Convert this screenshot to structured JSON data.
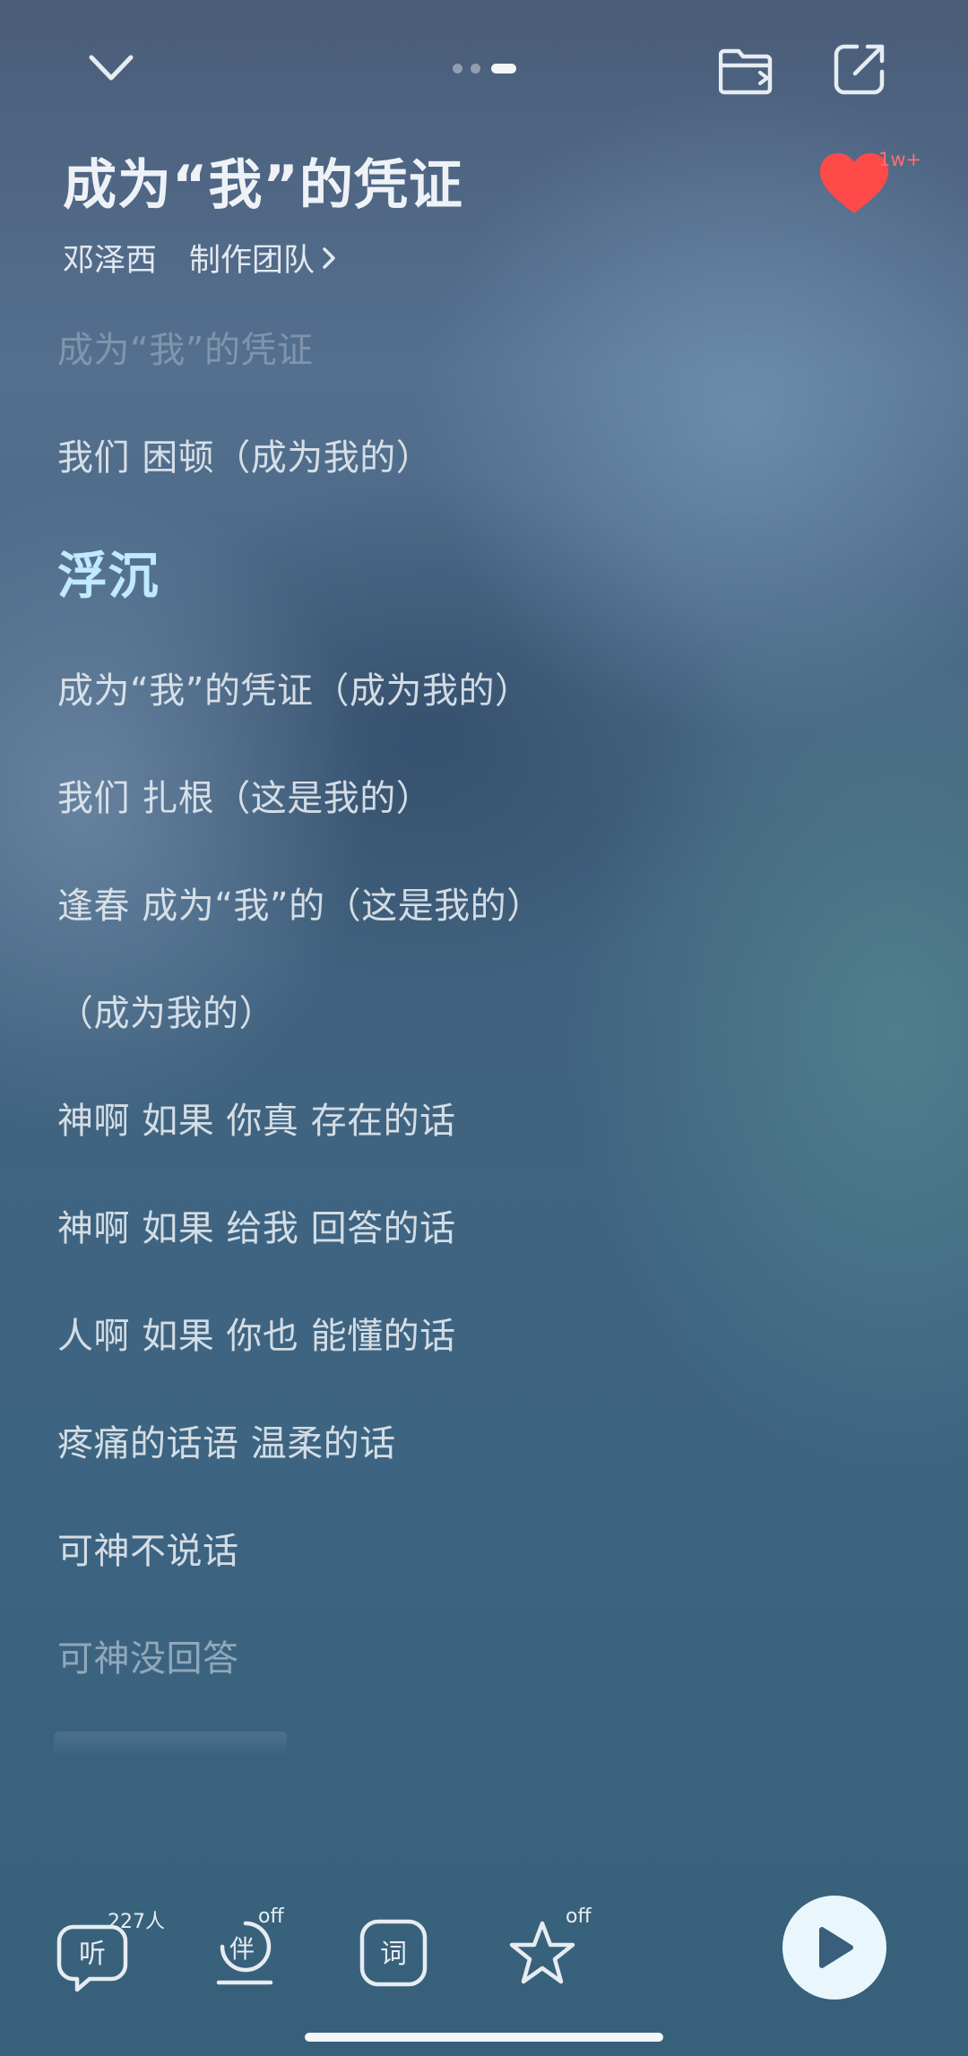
{
  "header": {
    "collapse_icon": "chevron-down-icon",
    "page_indicator": {
      "pages": 3,
      "active_index": 2
    },
    "folder_icon": "folder-swap-icon",
    "share_icon": "share-icon"
  },
  "song": {
    "title": "成为“我”的凭证",
    "artist": "邓泽西",
    "team_label": "制作团队",
    "like_count": "1w+",
    "like_icon": "heart-icon",
    "like_color": "#ff4a4a"
  },
  "lyrics": [
    {
      "text": "成为“我”的凭证",
      "state": "faded"
    },
    {
      "text": "我们 困顿（成为我的）",
      "state": "normal"
    },
    {
      "text": "浮沉",
      "state": "current"
    },
    {
      "text": "成为“我”的凭证（成为我的）",
      "state": "normal"
    },
    {
      "text": "我们 扎根（这是我的）",
      "state": "normal"
    },
    {
      "text": "逢春 成为“我”的（这是我的）",
      "state": "normal"
    },
    {
      "text": "（成为我的）",
      "state": "normal"
    },
    {
      "text": "神啊 如果 你真 存在的话",
      "state": "normal"
    },
    {
      "text": "神啊 如果 给我 回答的话",
      "state": "normal"
    },
    {
      "text": "人啊 如果 你也 能懂的话",
      "state": "normal"
    },
    {
      "text": "疼痛的话语 温柔的话",
      "state": "normal"
    },
    {
      "text": "可神不说话",
      "state": "normal"
    },
    {
      "text": "可神没回答",
      "state": "dim"
    }
  ],
  "toolbar": {
    "listen": {
      "glyph": "听",
      "badge": "227人"
    },
    "accompany": {
      "glyph": "伴",
      "badge": "off"
    },
    "lyric": {
      "glyph": "词"
    },
    "favorite": {
      "icon": "star-icon",
      "badge": "off"
    },
    "play_icon": "play-icon"
  },
  "colors": {
    "current_lyric": "#bfeaff",
    "play_button_bg": "#e9f7fc",
    "play_icon": "#3a5f7c"
  }
}
